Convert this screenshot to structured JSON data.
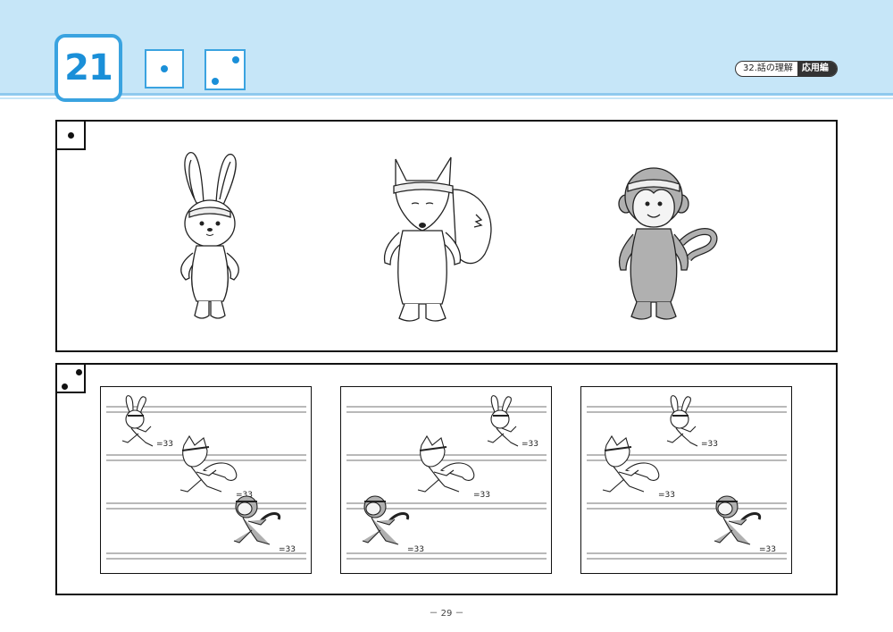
{
  "header": {
    "number": "21",
    "dice": [
      1,
      2
    ],
    "tag_left": "32.話の理解",
    "tag_right": "応用編"
  },
  "panels": [
    {
      "dice": 1,
      "characters": [
        "rabbit-icon",
        "fox-icon",
        "monkey-icon"
      ]
    },
    {
      "dice": 2,
      "scenes": [
        {
          "order": [
            "rabbit-icon",
            "fox-icon",
            "monkey-icon"
          ]
        },
        {
          "order": [
            "rabbit-icon",
            "fox-icon",
            "monkey-icon"
          ]
        },
        {
          "order": [
            "rabbit-icon",
            "fox-icon",
            "monkey-icon"
          ]
        }
      ]
    }
  ],
  "footer": {
    "page_number": "－ 29 －"
  },
  "colors": {
    "header_band": "#c6e6f8",
    "accent": "#1a8fd8",
    "monkey_fill": "#b0b0b0"
  }
}
